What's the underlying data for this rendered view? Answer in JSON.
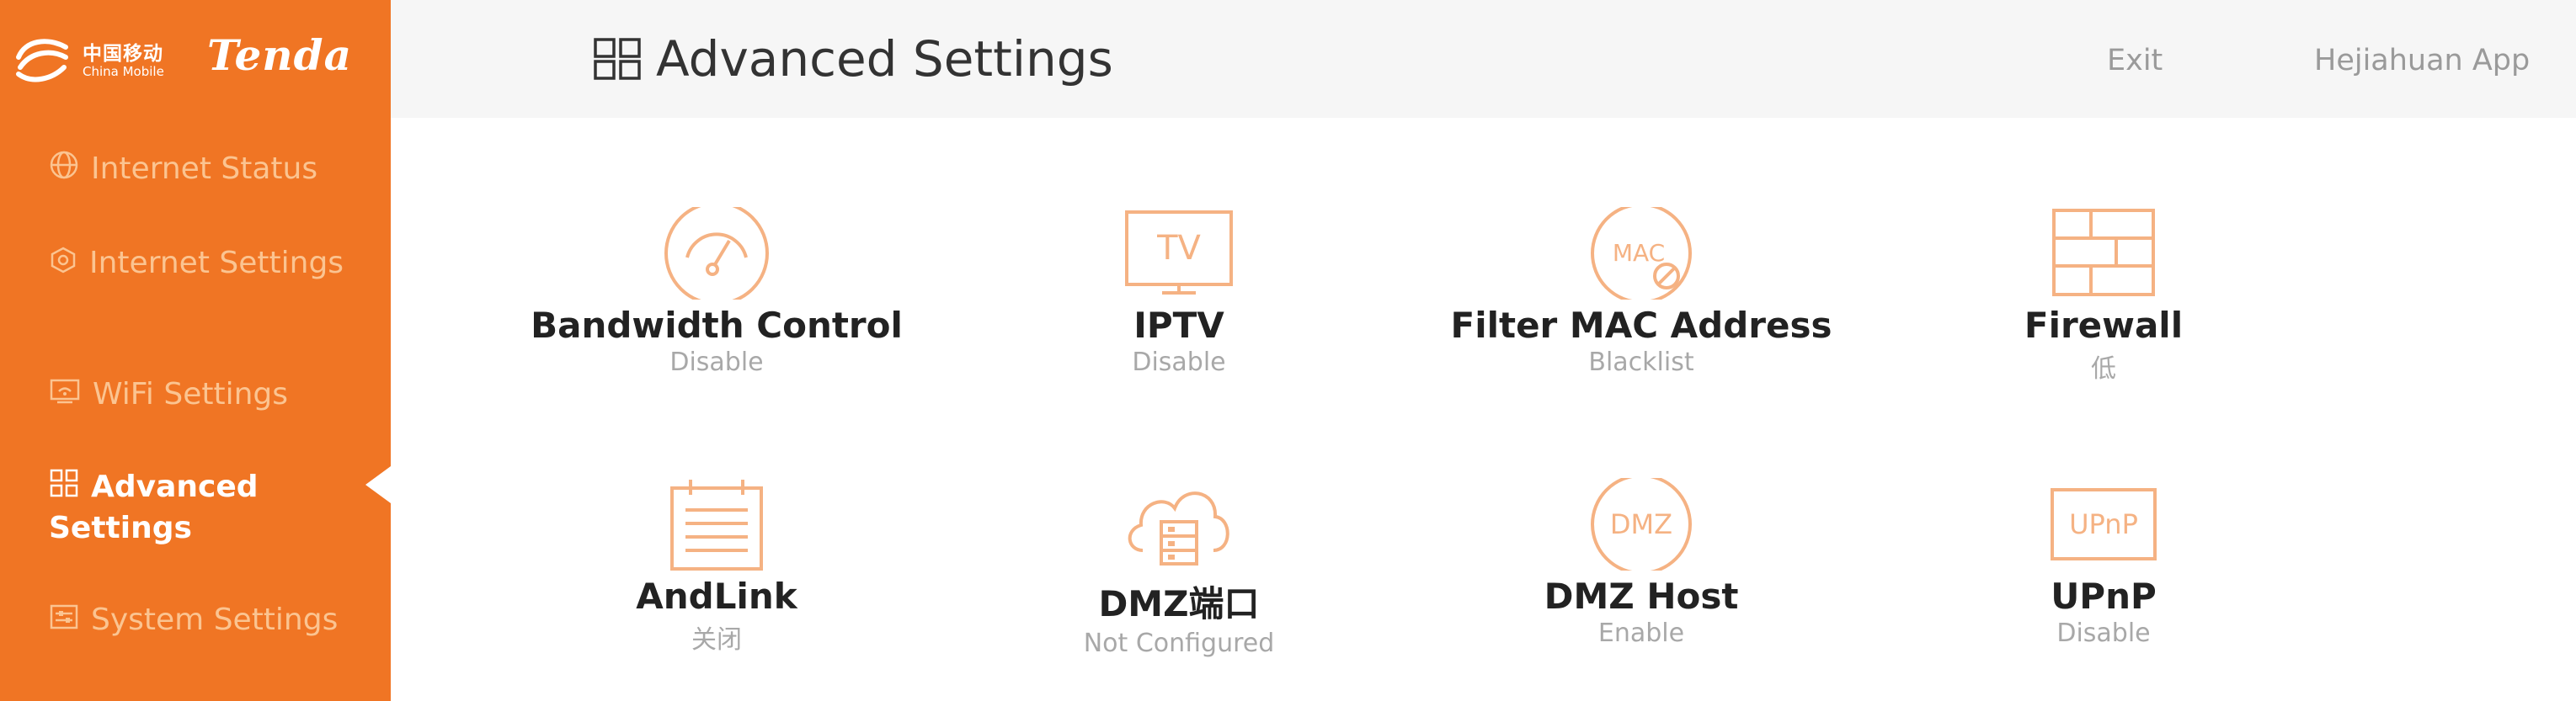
{
  "brand": {
    "carrier_cn": "中国移动",
    "carrier_en": "China Mobile",
    "name": "Tenda"
  },
  "sidebar": {
    "items": [
      {
        "label": "Internet Status",
        "icon": "globe-icon"
      },
      {
        "label": "Internet Settings",
        "icon": "network-icon"
      },
      {
        "label": "WiFi Settings",
        "icon": "wifi-screen-icon"
      },
      {
        "label": "Advanced Settings",
        "icon": "grid-icon",
        "active": true
      },
      {
        "label": "System Settings",
        "icon": "system-icon"
      }
    ]
  },
  "header": {
    "title": "Advanced Settings",
    "exit_label": "Exit",
    "app_label": "Hejiahuan App"
  },
  "tiles": [
    {
      "name": "Bandwidth Control",
      "status": "Disable",
      "icon": "speedometer-icon"
    },
    {
      "name": "IPTV",
      "status": "Disable",
      "icon": "tv-icon"
    },
    {
      "name": "Filter MAC Address",
      "status": "Blacklist",
      "icon": "mac-filter-icon"
    },
    {
      "name": "Firewall",
      "status": "低",
      "icon": "firewall-icon"
    },
    {
      "name": "AndLink",
      "status": "关闭",
      "icon": "list-notebook-icon"
    },
    {
      "name": "DMZ端口",
      "status": "Not Configured",
      "icon": "cloud-server-icon"
    },
    {
      "name": "DMZ Host",
      "status": "Enable",
      "icon": "dmz-icon"
    },
    {
      "name": "UPnP",
      "status": "Disable",
      "icon": "upnp-icon"
    }
  ],
  "icon_text": {
    "tv": "TV",
    "mac": "MAC",
    "dmz": "DMZ",
    "upnp": "UPnP"
  },
  "colors": {
    "sidebar": "#f07524",
    "icon_accent": "#f5b283",
    "nav_inactive": "#fbc491",
    "header_bg": "#f6f6f6"
  }
}
